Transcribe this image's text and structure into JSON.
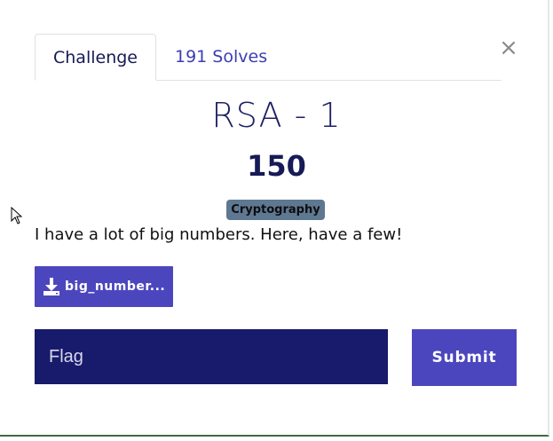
{
  "modal": {
    "close_glyph": "×",
    "tabs": [
      {
        "label": "Challenge",
        "active": true
      },
      {
        "label": "191 Solves",
        "active": false
      }
    ],
    "challenge": {
      "name": "RSA - 1",
      "points": "150",
      "category": "Cryptography",
      "description": "I have a lot of big numbers. Here, have a few!",
      "file_label": "big_number...",
      "file_icon": "download-icon"
    },
    "flag_form": {
      "placeholder": "Flag",
      "value": "",
      "submit_label": "Submit"
    }
  },
  "colors": {
    "primary": "#4c46be",
    "dark": "#181a6b",
    "title": "#1e2166",
    "badge": "#5f7892"
  }
}
